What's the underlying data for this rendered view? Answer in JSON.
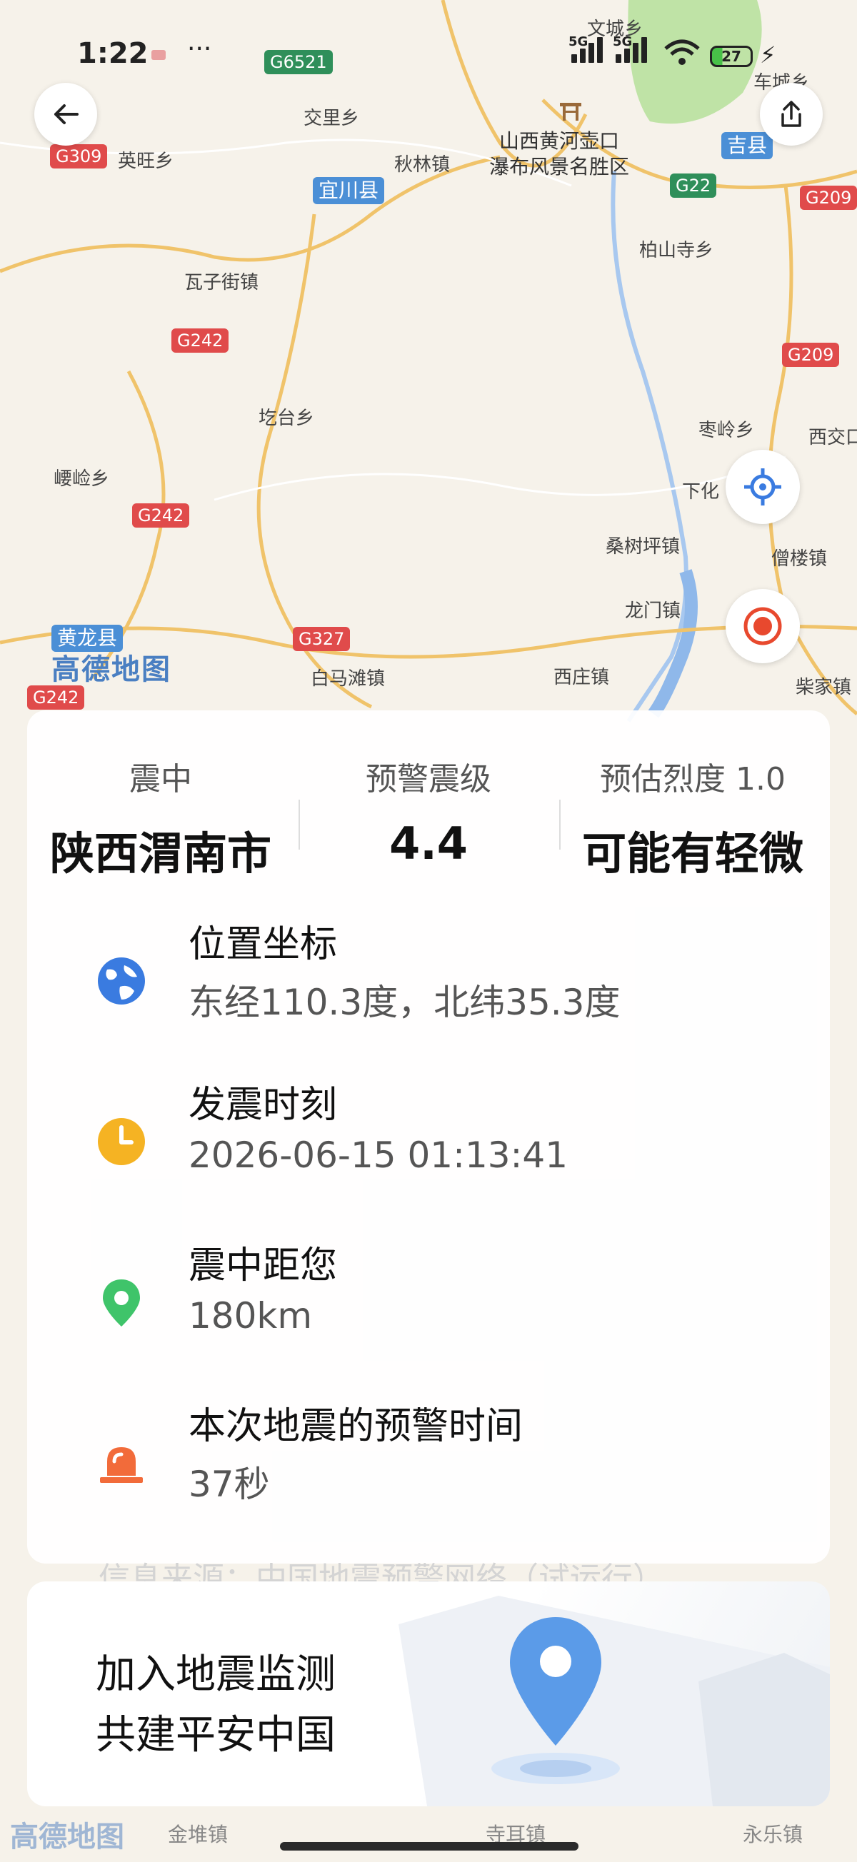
{
  "status_bar": {
    "time": "1:22",
    "dots": "···",
    "signal1_tag": "5G",
    "signal2_tag": "5G",
    "battery": "27"
  },
  "map": {
    "logo": "高德地图",
    "labels": [
      {
        "text": "文城乡"
      },
      {
        "text": "交里乡"
      },
      {
        "text": "英旺乡"
      },
      {
        "text": "秋林镇"
      },
      {
        "text": "瓦子街镇"
      },
      {
        "text": "柏山寺乡"
      },
      {
        "text": "圪台乡"
      },
      {
        "text": "崾崄乡"
      },
      {
        "text": "枣岭乡"
      },
      {
        "text": "西交口"
      },
      {
        "text": "下化"
      },
      {
        "text": "桑树坪镇"
      },
      {
        "text": "僧楼镇"
      },
      {
        "text": "龙门镇"
      },
      {
        "text": "白马滩镇"
      },
      {
        "text": "西庄镇"
      },
      {
        "text": "柴家镇"
      },
      {
        "text": "车城乡"
      }
    ],
    "roads": [
      {
        "text": "G6521",
        "style": "green"
      },
      {
        "text": "G309",
        "style": "red"
      },
      {
        "text": "G22",
        "style": "green"
      },
      {
        "text": "G209",
        "style": "red"
      },
      {
        "text": "G242",
        "style": "red"
      },
      {
        "text": "G209",
        "style": "red"
      },
      {
        "text": "G242",
        "style": "red"
      },
      {
        "text": "G327",
        "style": "red"
      },
      {
        "text": "G242",
        "style": "red"
      }
    ],
    "towns": [
      {
        "text": "宜川县"
      },
      {
        "text": "吉县"
      },
      {
        "text": "黄龙县"
      }
    ],
    "scenic": {
      "line1": "山西黄河壶口",
      "line2": "瀑布风景名胜区"
    }
  },
  "summary": {
    "epicenter_label": "震中",
    "magnitude_label": "预警震级",
    "intensity_label": "预估烈度 1.0",
    "epicenter_value": "陕西渭南市",
    "magnitude_value": "4.4",
    "intensity_value": "可能有轻微"
  },
  "details": [
    {
      "title": "位置坐标",
      "value": "东经110.3度，北纬35.3度",
      "icon": "globe-icon"
    },
    {
      "title": "发震时刻",
      "value": "2026-06-15 01:13:41",
      "icon": "clock-icon"
    },
    {
      "title": "震中距您",
      "value": "180km",
      "icon": "location-pin-icon"
    },
    {
      "title": "本次地震的预警时间",
      "value": "37秒",
      "icon": "alarm-light-icon"
    }
  ],
  "card_fade_text": "信息来源：中国地震预警网络（试运行）",
  "promo": {
    "line1": "加入地震监测",
    "line2": "共建平安中国"
  },
  "bottom": {
    "logo": "高德地图",
    "labels": [
      "金堆镇",
      "寺耳镇",
      "永乐镇"
    ]
  },
  "colors": {
    "globe": "#3a7be0",
    "clock": "#f5b323",
    "pin": "#3fc46a",
    "alarm": "#f26b3a",
    "locate": "#3a7be0",
    "epicenter_btn": "#e8492e"
  }
}
